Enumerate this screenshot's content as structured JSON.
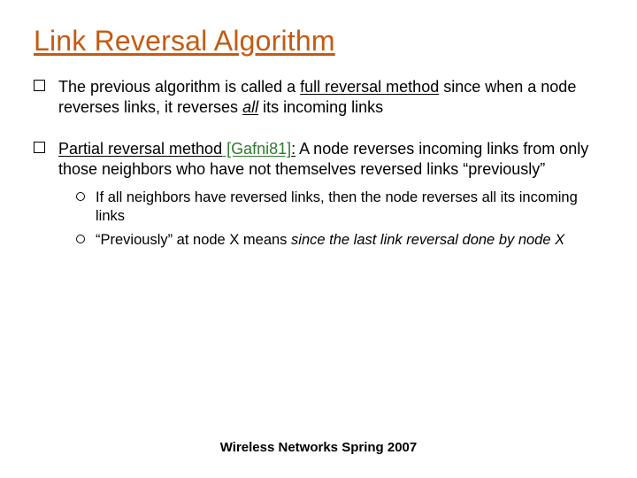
{
  "title": "Link Reversal Algorithm",
  "b1": {
    "p1": "The previous algorithm is called a ",
    "full_reversal": "full reversal method",
    "p2": " since when a node reverses links, it reverses ",
    "all": "all",
    "p3": " its incoming links"
  },
  "b2": {
    "partial": "Partial reversal method",
    "ref": " [Gafni81]",
    "colon": ":",
    "p1": " A node reverses incoming links from only those neighbors who have not themselves reversed links “previously”",
    "sub1": "If all neighbors have reversed links, then the node reverses all its incoming links",
    "sub2a": "“Previously” at node X means ",
    "sub2b": "since the last link reversal done by node X"
  },
  "footer": "Wireless Networks Spring 2007"
}
